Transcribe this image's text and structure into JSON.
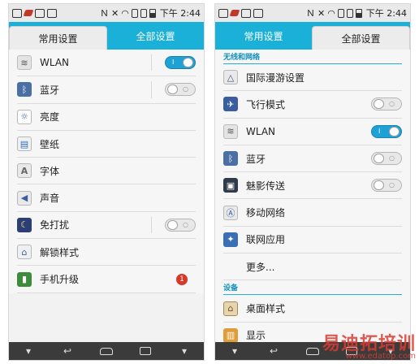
{
  "status_bar": {
    "time": "下午 2:44"
  },
  "left_phone": {
    "tabs": [
      {
        "label": "常用设置",
        "active": true
      },
      {
        "label": "全部设置",
        "active": false
      }
    ],
    "items": [
      {
        "label": "WLAN",
        "icon": "wifi-icon",
        "toggle": "on"
      },
      {
        "label": "蓝牙",
        "icon": "bluetooth-icon",
        "toggle": "off"
      },
      {
        "label": "亮度",
        "icon": "brightness-icon"
      },
      {
        "label": "壁纸",
        "icon": "wallpaper-icon"
      },
      {
        "label": "字体",
        "icon": "font-icon"
      },
      {
        "label": "声音",
        "icon": "sound-icon"
      },
      {
        "label": "免打扰",
        "icon": "moon-icon",
        "toggle": "off"
      },
      {
        "label": "解锁样式",
        "icon": "lock-icon"
      },
      {
        "label": "手机升级",
        "icon": "upgrade-icon",
        "badge": "1"
      }
    ]
  },
  "right_phone": {
    "tabs": [
      {
        "label": "常用设置",
        "active": false
      },
      {
        "label": "全部设置",
        "active": true
      }
    ],
    "section_wireless": "无线和网络",
    "items_wireless": [
      {
        "label": "国际漫游设置",
        "icon": "roaming-icon"
      },
      {
        "label": "飞行模式",
        "icon": "airplane-icon",
        "toggle": "off"
      },
      {
        "label": "WLAN",
        "icon": "wifi-icon",
        "toggle": "on"
      },
      {
        "label": "蓝牙",
        "icon": "bluetooth-icon",
        "toggle": "off"
      },
      {
        "label": "魅影传送",
        "icon": "share-icon",
        "toggle": "off"
      },
      {
        "label": "移动网络",
        "icon": "mobile-network-icon"
      },
      {
        "label": "联网应用",
        "icon": "network-apps-icon"
      },
      {
        "label": "更多...",
        "icon": null
      }
    ],
    "section_device": "设备",
    "items_device": [
      {
        "label": "桌面样式",
        "icon": "home-style-icon"
      },
      {
        "label": "显示",
        "icon": "display-icon"
      }
    ]
  },
  "watermark": {
    "chinese": "易迪拓培训",
    "url": "www.edatop.com"
  },
  "colors": {
    "accent": "#1ab0d8",
    "toggle_on": "#1ea2d6",
    "badge": "#d8382a",
    "nav_bar": "#3b3b3b"
  }
}
